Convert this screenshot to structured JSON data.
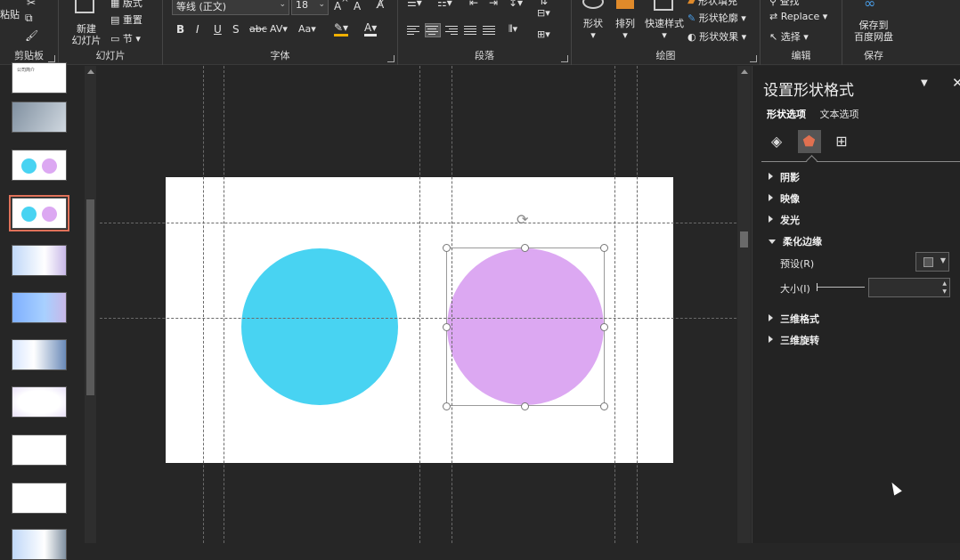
{
  "ribbon": {
    "clipboard": {
      "paste_label": "粘贴",
      "group_label": "剪贴板"
    },
    "slides": {
      "new_slide_line1": "新建",
      "new_slide_line2": "幻灯片",
      "layout_label": "版式",
      "reset_label": "重置",
      "section_label": "节",
      "group_label": "幻灯片"
    },
    "font": {
      "font_name": "等线 (正文)",
      "font_size": "18",
      "group_label": "字体",
      "char_spacing": "AV",
      "change_case": "Aa"
    },
    "paragraph": {
      "group_label": "段落"
    },
    "drawing": {
      "shapes_label": "形状",
      "arrange_label": "排列",
      "quick_styles_label": "快速样式",
      "shape_fill_label": "形状填充",
      "shape_outline_label": "形状轮廓",
      "shape_effects_label": "形状效果",
      "group_label": "绘图"
    },
    "editing": {
      "find_label": "查找",
      "replace_label": "Replace",
      "select_label": "选择",
      "group_label": "编辑"
    },
    "save": {
      "save_line1": "保存到",
      "save_line2": "百度网盘",
      "group_label": "保存"
    }
  },
  "thumbnails": [
    {
      "caption": "公司简介",
      "kind": "text"
    },
    {
      "caption": "",
      "kind": "photo"
    },
    {
      "caption": "",
      "kind": "circles"
    },
    {
      "caption": "",
      "kind": "circles",
      "selected": true
    },
    {
      "caption": "",
      "kind": "banner"
    },
    {
      "caption": "",
      "kind": "banner"
    },
    {
      "caption": "",
      "kind": "building"
    },
    {
      "caption": "",
      "kind": "blank"
    },
    {
      "caption": "",
      "kind": "text"
    },
    {
      "caption": "",
      "kind": "text"
    },
    {
      "caption": "",
      "kind": "banner"
    }
  ],
  "slide": {
    "left_circle_color": "#48d3f2",
    "right_circle_color": "#dca8f2"
  },
  "format_pane": {
    "title": "设置形状格式",
    "tab_shape": "形状选项",
    "tab_text": "文本选项",
    "sections": {
      "shadow": "阴影",
      "reflection": "映像",
      "glow": "发光",
      "soft_edges": "柔化边缘",
      "three_d_format": "三维格式",
      "three_d_rotation": "三维旋转"
    },
    "preset_label": "预设(R)",
    "size_label": "大小(I)",
    "size_value": ""
  }
}
